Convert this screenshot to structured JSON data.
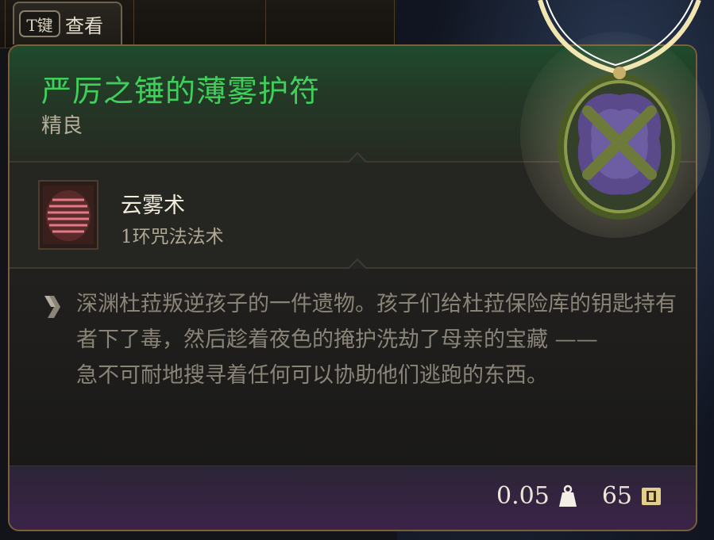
{
  "view_tab": {
    "key": "T键",
    "label": "查看"
  },
  "item": {
    "name": "严厉之锤的薄雾护符",
    "rarity": "精良",
    "name_color": "#3fcf5a"
  },
  "spell": {
    "icon": "fog-cloud-spell-icon",
    "name": "云雾术",
    "level": "1环咒法法术"
  },
  "description": {
    "icon": "lore-quill-icon",
    "paragraph1": "深渊杜菈叛逆孩子的一件遗物。孩子们给杜菈保险库的钥匙持有者下了毒，然后趁着夜色的掩护洗劫了母亲的宝藏 ——",
    "paragraph2": "急不可耐地搜寻着任何可以协助他们逃跑的东西。"
  },
  "footer": {
    "weight": "0.05",
    "weight_icon": "weight-icon",
    "value": "65",
    "value_icon": "gold-coin-icon"
  }
}
